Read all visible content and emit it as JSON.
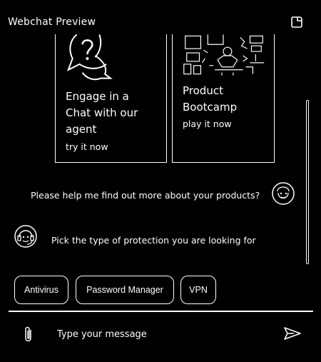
{
  "header": {
    "title": "Webchat Preview",
    "restart_icon": "restart-icon"
  },
  "cards": [
    {
      "title_lines": [
        "Engage in a",
        "Chat with our",
        "agent"
      ],
      "cta": "try it now",
      "icon": "chat-question-icon"
    },
    {
      "title_lines": [
        "Product",
        "Bootcamp"
      ],
      "cta": "play it now",
      "icon": "bootcamp-illustration"
    }
  ],
  "messages": [
    {
      "from": "user",
      "text": "Please help me find out more about your products?"
    },
    {
      "from": "bot",
      "text": "Pick the type of protection you are looking for"
    }
  ],
  "quick_replies": [
    "Antivirus",
    "Password Manager",
    "VPN"
  ],
  "composer": {
    "placeholder": "Type your message",
    "attach_icon": "paperclip-icon",
    "send_icon": "send-icon"
  }
}
